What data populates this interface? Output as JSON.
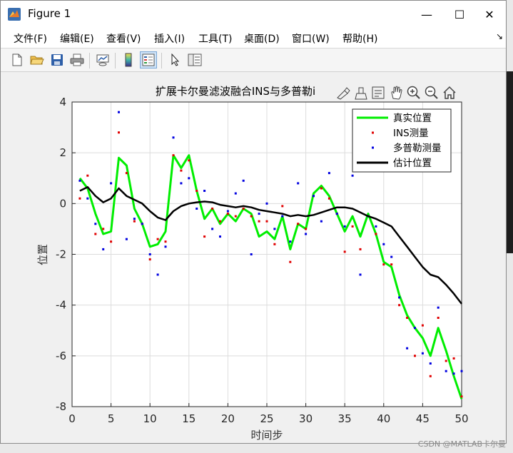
{
  "window": {
    "title": "Figure 1",
    "controls": {
      "minimize": "—",
      "maximize": "☐",
      "close": "✕"
    }
  },
  "menu": [
    {
      "label": "文件(F)"
    },
    {
      "label": "编辑(E)"
    },
    {
      "label": "查看(V)"
    },
    {
      "label": "插入(I)"
    },
    {
      "label": "工具(T)"
    },
    {
      "label": "桌面(D)"
    },
    {
      "label": "窗口(W)"
    },
    {
      "label": "帮助(H)"
    }
  ],
  "menu_overflow": "↘",
  "toolbar": [
    {
      "icon": "new-figure-icon"
    },
    {
      "icon": "open-file-icon"
    },
    {
      "icon": "save-icon"
    },
    {
      "icon": "print-icon"
    },
    {
      "icon": "link-plot-icon"
    },
    {
      "icon": "colorbar-icon"
    },
    {
      "icon": "legend-icon",
      "pressed": true
    },
    {
      "icon": "edit-plot-arrow-icon"
    },
    {
      "icon": "property-inspector-icon"
    }
  ],
  "axes_toolbar": [
    "brush-export-icon",
    "data-brush-icon",
    "data-tip-icon",
    "pan-icon",
    "zoom-in-icon",
    "zoom-out-icon",
    "home-icon"
  ],
  "watermark": "CSDN @MATLAB卡尔曼",
  "colors": {
    "true": "#00ee00",
    "ins": "#e00000",
    "doppler": "#0000e0",
    "estimate": "#000000",
    "grid": "#dcdcdc"
  },
  "chart_data": {
    "type": "line",
    "title": "扩展卡尔曼滤波融合INS与多普勒i",
    "xlabel": "时间步",
    "ylabel": "位置",
    "xlim": [
      0,
      50
    ],
    "ylim": [
      -8,
      4
    ],
    "xticks": [
      0,
      5,
      10,
      15,
      20,
      25,
      30,
      35,
      40,
      45,
      50
    ],
    "yticks": [
      -8,
      -6,
      -4,
      -2,
      0,
      2,
      4
    ],
    "grid": true,
    "legend_position": "top-right",
    "x": [
      1,
      2,
      3,
      4,
      5,
      6,
      7,
      8,
      9,
      10,
      11,
      12,
      13,
      14,
      15,
      16,
      17,
      18,
      19,
      20,
      21,
      22,
      23,
      24,
      25,
      26,
      27,
      28,
      29,
      30,
      31,
      32,
      33,
      34,
      35,
      36,
      37,
      38,
      39,
      40,
      41,
      42,
      43,
      44,
      45,
      46,
      47,
      48,
      49,
      50
    ],
    "series": [
      {
        "name": "真实位置",
        "style": "line",
        "color": "#00ee00",
        "values": [
          1.0,
          0.6,
          -0.4,
          -1.2,
          -1.1,
          1.8,
          1.5,
          -0.2,
          -0.8,
          -1.7,
          -1.6,
          -1.1,
          1.9,
          1.4,
          1.9,
          0.5,
          -0.6,
          -0.2,
          -0.8,
          -0.4,
          -0.7,
          -0.2,
          -0.4,
          -1.3,
          -1.1,
          -1.4,
          -0.5,
          -1.8,
          -0.8,
          -1.0,
          0.4,
          0.7,
          0.3,
          -0.4,
          -1.1,
          -0.5,
          -1.3,
          -0.4,
          -1.2,
          -2.3,
          -2.5,
          -3.6,
          -4.4,
          -4.9,
          -5.3,
          -6.0,
          -4.9,
          -5.8,
          -6.8,
          -7.7
        ]
      },
      {
        "name": "INS测量",
        "style": "marker",
        "color": "#e00000",
        "values": [
          0.2,
          1.1,
          -1.2,
          -1.0,
          -1.5,
          2.8,
          1.2,
          -0.7,
          -0.8,
          -2.2,
          -1.4,
          -1.5,
          1.9,
          1.3,
          1.7,
          0.5,
          -1.3,
          -0.2,
          -0.7,
          -0.4,
          -0.5,
          -0.2,
          -0.5,
          -0.7,
          -0.7,
          -1.6,
          -0.1,
          -2.3,
          -0.8,
          -1.0,
          0.3,
          0.6,
          0.2,
          -0.4,
          -1.9,
          -0.9,
          -1.8,
          -0.5,
          -1.2,
          -2.4,
          -2.4,
          -4.0,
          -4.5,
          -6.0,
          -4.8,
          -6.8,
          -4.5,
          -6.2,
          -6.1,
          -7.6
        ]
      },
      {
        "name": "多普勒测量",
        "style": "marker",
        "color": "#0000e0",
        "values": [
          0.9,
          0.2,
          -0.8,
          -1.8,
          0.8,
          3.6,
          -1.4,
          -0.6,
          -0.8,
          -2.0,
          -2.8,
          -1.7,
          2.6,
          0.8,
          1.0,
          -0.2,
          0.5,
          -1.0,
          -1.3,
          -0.3,
          0.4,
          0.9,
          -2.0,
          -0.4,
          0.0,
          -1.0,
          -0.5,
          -1.5,
          0.8,
          -1.2,
          0.3,
          -0.7,
          1.2,
          -0.4,
          -0.9,
          1.1,
          -2.8,
          -0.5,
          -0.9,
          -1.6,
          -2.1,
          -3.7,
          -5.7,
          -4.9,
          -5.9,
          -6.3,
          -4.1,
          -6.6,
          -6.7,
          -6.6
        ]
      },
      {
        "name": "估计位置",
        "style": "line",
        "color": "#000000",
        "values": [
          0.5,
          0.65,
          0.3,
          0.05,
          0.2,
          0.6,
          0.3,
          0.15,
          0.0,
          -0.3,
          -0.55,
          -0.65,
          -0.3,
          -0.1,
          0.0,
          0.05,
          0.08,
          0.05,
          -0.05,
          -0.1,
          -0.15,
          -0.1,
          -0.15,
          -0.25,
          -0.3,
          -0.35,
          -0.4,
          -0.5,
          -0.45,
          -0.5,
          -0.45,
          -0.35,
          -0.25,
          -0.15,
          -0.15,
          -0.2,
          -0.35,
          -0.5,
          -0.6,
          -0.75,
          -0.9,
          -1.3,
          -1.7,
          -2.1,
          -2.5,
          -2.8,
          -2.9,
          -3.2,
          -3.55,
          -3.95
        ]
      }
    ]
  }
}
